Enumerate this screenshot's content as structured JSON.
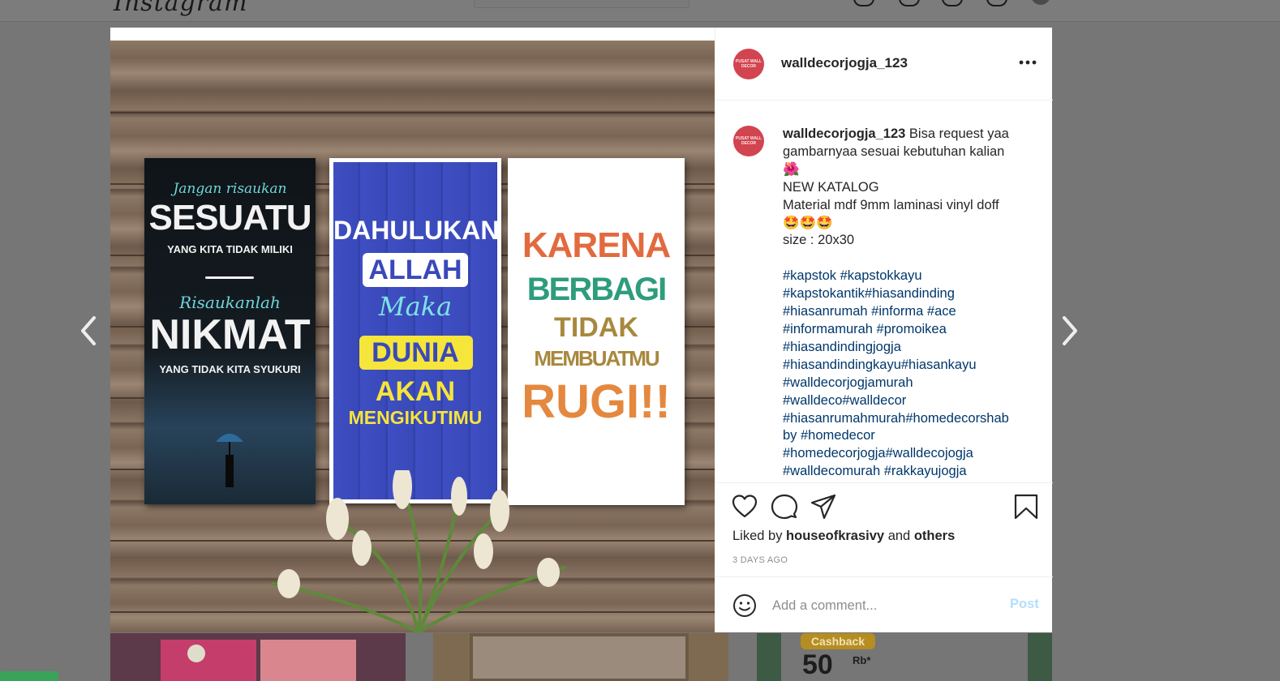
{
  "topnav": {
    "logo": "Instagram"
  },
  "post": {
    "username": "walldecorjogja_123",
    "avatar_text": "PUSAT WALL DECOR",
    "caption_lines": [
      {
        "user": "walldecorjogja_123",
        "text": " Bisa request yaa"
      },
      {
        "text": "gambarnyaa sesuai kebutuhan kalian"
      },
      {
        "text": "🌺"
      },
      {
        "text": "NEW KATALOG"
      },
      {
        "text": "Material mdf 9mm laminasi vinyl doff"
      },
      {
        "text": "🤩🤩🤩"
      },
      {
        "text": "size : 20x30"
      },
      {
        "text": ""
      },
      {
        "tag": "#kapstok #kapstokkayu"
      },
      {
        "tag": "#kapstokantik#hiasandinding"
      },
      {
        "tag": "#hiasanrumah #informa #ace"
      },
      {
        "tag": "#informamurah #promoikea"
      },
      {
        "tag": "#hiasandindingjogja"
      },
      {
        "tag": "#hiasandindingkayu#hiasankayu"
      },
      {
        "tag": "#walldecorjogjamurah"
      },
      {
        "tag": "#walldeco#walldecor"
      },
      {
        "tag": "#hiasanrumahmurah#homedecorshab"
      },
      {
        "tag": "by #homedecor"
      },
      {
        "tag": "#homedecorjogja#walldecojogja"
      },
      {
        "tag": "#walldecomurah #rakkayujogja"
      }
    ],
    "liked_by_prefix": "Liked by ",
    "liked_by_user": "houseofkrasivy",
    "liked_by_and": " and ",
    "liked_by_others": "others",
    "time_ago": "3 DAYS AGO",
    "comment_placeholder": "Add a comment...",
    "post_label": "Post"
  },
  "image": {
    "panel1": {
      "line1": "Jangan risaukan",
      "line2": "SESUATU",
      "line3": "YANG KITA TIDAK MILIKI",
      "line4": "Risaukanlah",
      "line5": "NIKMAT",
      "line6": "YANG TIDAK KITA SYUKURI"
    },
    "panel2": {
      "line1": "DAHULUKAN",
      "line2": "ALLAH",
      "line3": "Maka",
      "line4": "DUNIA",
      "line5": "AKAN",
      "line6": "MENGIKUTIMU"
    },
    "panel3": {
      "line1": "KARENA",
      "line2": "BERBAGI",
      "line3": "TIDAK",
      "line4": "MEMBUATMU",
      "line5": "RUGI!!"
    }
  },
  "background_tiles": {
    "cashback_label": "Cashback",
    "cashback_amount": "50",
    "cashback_unit": "Rb*"
  },
  "icons": {
    "prev": "chevron-left-icon",
    "next": "chevron-right-icon",
    "like": "heart-icon",
    "comment": "comment-icon",
    "share": "paper-plane-icon",
    "save": "bookmark-icon",
    "emoji": "smiley-icon",
    "more": "more-horizontal-icon"
  },
  "colors": {
    "link_blue": "#00376b",
    "post_button_disabled": "#b2dffc",
    "avatar_red": "#d2444f"
  }
}
